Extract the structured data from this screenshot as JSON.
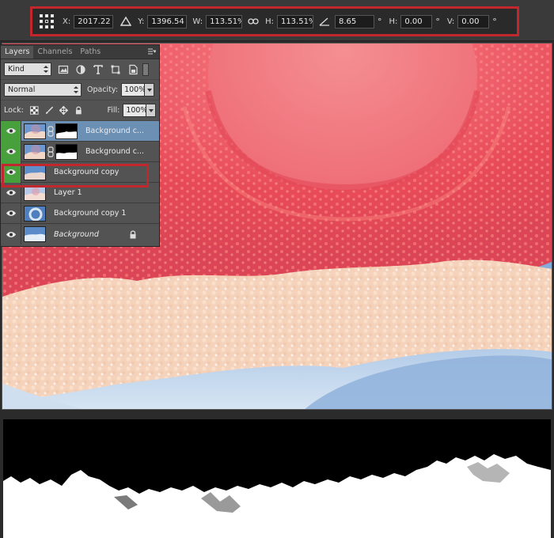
{
  "options_bar": {
    "x_label": "X:",
    "x_value": "2017.22 px",
    "y_label": "Y:",
    "y_value": "1396.54 px",
    "w_label": "W:",
    "w_value": "113.51%",
    "h_label": "H:",
    "h_value": "113.51%",
    "angle_value": "8.65",
    "degree_symbol": "°",
    "hskew_label": "H:",
    "hskew_value": "0.00",
    "vskew_label": "V:",
    "vskew_value": "0.00",
    "highlight_color": "#c1272d"
  },
  "layers_panel": {
    "tabs": [
      {
        "label": "Layers",
        "active": true
      },
      {
        "label": "Channels",
        "active": false
      },
      {
        "label": "Paths",
        "active": false
      }
    ],
    "filter_kind": "Kind",
    "blend_mode": "Normal",
    "opacity_label": "Opacity:",
    "opacity_value": "100%",
    "lock_label": "Lock:",
    "fill_label": "Fill:",
    "fill_value": "100%",
    "layers": [
      {
        "name": "Background c...",
        "visible": true,
        "highlight": "green",
        "selected": true,
        "has_mask": true
      },
      {
        "name": "Background c...",
        "visible": true,
        "highlight": "green",
        "selected": false,
        "has_mask": true
      },
      {
        "name": "Background copy",
        "visible": true,
        "highlight": "green",
        "selected": false,
        "has_mask": false
      },
      {
        "name": "Layer 1",
        "visible": true,
        "highlight": "none",
        "selected": false,
        "has_mask": false
      },
      {
        "name": "Background copy 1",
        "visible": true,
        "highlight": "none",
        "selected": false,
        "has_mask": false
      },
      {
        "name": "Background",
        "visible": true,
        "highlight": "none",
        "selected": false,
        "has_mask": false,
        "locked": true,
        "italic": true
      }
    ],
    "selection_color": "#6c8fb4",
    "visibility_highlight_color": "#48a03c"
  },
  "icons": [
    "reference-point-grid-icon",
    "skew-triangle-icon",
    "link-icon",
    "angle-icon",
    "eye-icon",
    "lock-icon",
    "chain-link-icon"
  ]
}
